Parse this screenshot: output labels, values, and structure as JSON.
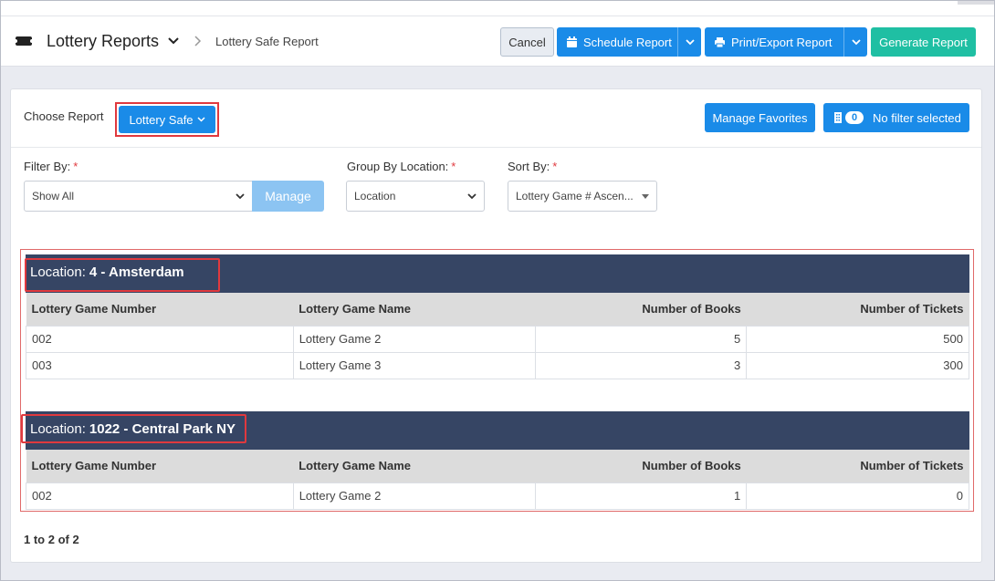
{
  "header": {
    "app_title": "Lottery Reports",
    "breadcrumb_current": "Lottery Safe Report",
    "cancel_label": "Cancel",
    "schedule_label": "Schedule Report",
    "print_label": "Print/Export Report",
    "generate_label": "Generate Report"
  },
  "controls": {
    "choose_report_label": "Choose Report",
    "report_selected": "Lottery Safe",
    "manage_favorites_label": "Manage Favorites",
    "filter_count": "0",
    "filter_status": "No filter selected",
    "filter_by_label": "Filter By:",
    "filter_by_value": "Show All",
    "manage_label": "Manage",
    "group_by_label": "Group By Location:",
    "group_by_value": "Location",
    "sort_by_label": "Sort By:",
    "sort_by_value": "Lottery Game # Ascen...",
    "required_mark": "*"
  },
  "table_headers": [
    "Lottery Game Number",
    "Lottery Game Name",
    "Number of Books",
    "Number of Tickets"
  ],
  "location_prefix": "Location:",
  "groups": [
    {
      "location": "4 - Amsterdam",
      "rows": [
        {
          "number": "002",
          "name": "Lottery Game 2",
          "books": "5",
          "tickets": "500"
        },
        {
          "number": "003",
          "name": "Lottery Game 3",
          "books": "3",
          "tickets": "300"
        }
      ]
    },
    {
      "location": "1022 - Central Park NY",
      "rows": [
        {
          "number": "002",
          "name": "Lottery Game 2",
          "books": "1",
          "tickets": "0"
        }
      ]
    }
  ],
  "pager": {
    "text": "1 to 2 of 2"
  },
  "colors": {
    "primary": "#1a8be8",
    "success": "#1fbfa3",
    "header_dark": "#364564",
    "highlight": "#e0393e"
  }
}
